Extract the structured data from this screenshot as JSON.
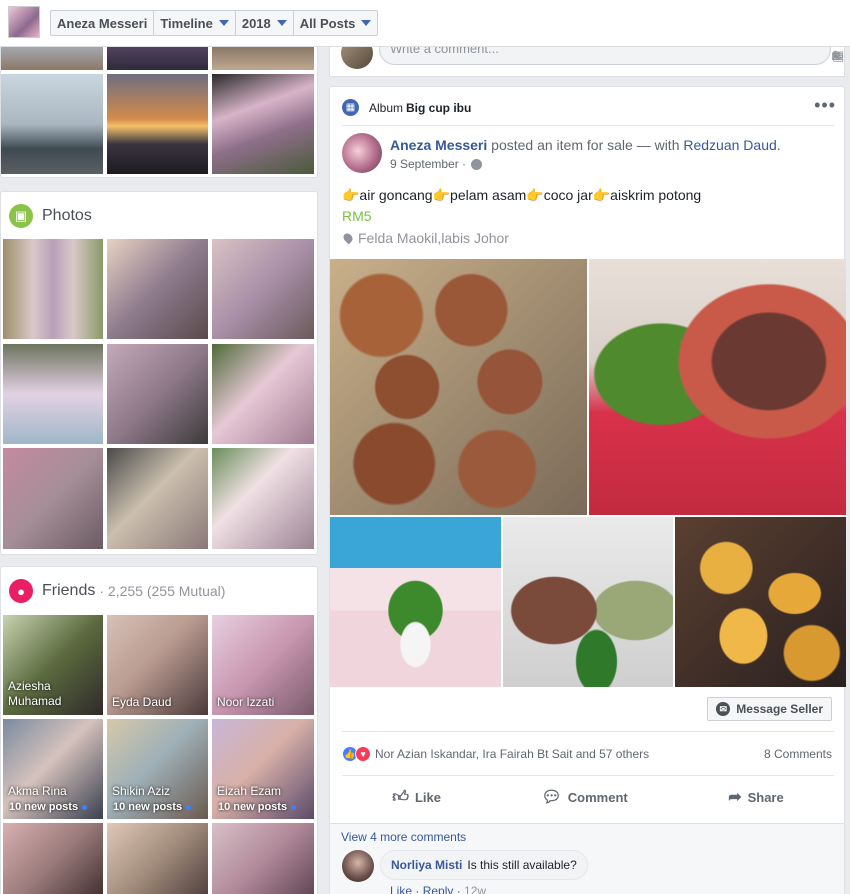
{
  "header": {
    "crumbs": [
      {
        "label": "Aneza Messeri",
        "dropdown": false
      },
      {
        "label": "Timeline",
        "dropdown": true
      },
      {
        "label": "2018",
        "dropdown": true
      },
      {
        "label": "All Posts",
        "dropdown": true
      }
    ]
  },
  "sidebar": {
    "photos": {
      "title": "Photos"
    },
    "friends": {
      "title": "Friends",
      "count": "· 2,255 (255 Mutual)",
      "items": [
        {
          "name": "Aziesha Muhamad",
          "new_posts": ""
        },
        {
          "name": "Eyda Daud",
          "new_posts": ""
        },
        {
          "name": "Noor Izzati",
          "new_posts": ""
        },
        {
          "name": "Akma Rina",
          "new_posts": "10 new posts"
        },
        {
          "name": "Shikin Aziz",
          "new_posts": "10 new posts"
        },
        {
          "name": "Eizah Ezam",
          "new_posts": "10 new posts"
        }
      ]
    }
  },
  "prev_post": {
    "comment_placeholder": "Write a comment..."
  },
  "post": {
    "album_prefix": "Album",
    "album_name": "Big cup ibu",
    "author": "Aneza Messeri",
    "action_text": "posted an item for sale — with",
    "tagged": "Redzuan Daud",
    "date": "9 September ·",
    "text": "👉air goncang👉pelam asam👉coco jar👉aiskrim potong",
    "price": "RM5",
    "location": "Felda Maokil,labis Johor",
    "message_seller": "Message Seller",
    "reactions_text": "Nor Azian Iskandar, Ira Fairah Bt Sait and 57 others",
    "comments_count": "8 Comments",
    "actions": {
      "like": "Like",
      "comment": "Comment",
      "share": "Share"
    },
    "view_more": "View 4 more comments",
    "comment": {
      "author": "Norliya Misti",
      "text": "Is this still available?",
      "like": "Like",
      "reply": "Reply",
      "time": "12w"
    }
  },
  "colors": {
    "link": "#365899",
    "price": "#7ac142",
    "photos_icon": "#8bc34a",
    "friends_icon": "#e91e63"
  },
  "icons": [
    "search-icon",
    "photos-icon",
    "friends-icon",
    "globe-icon",
    "location-pin-icon",
    "messenger-icon",
    "like-icon",
    "comment-icon",
    "share-icon",
    "more-dots-icon",
    "album-icon"
  ]
}
